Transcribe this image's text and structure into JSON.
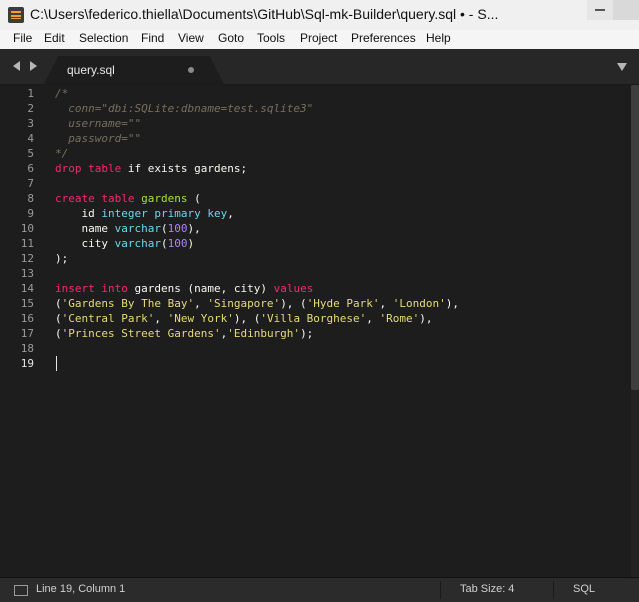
{
  "window": {
    "title": "C:\\Users\\federico.thiella\\Documents\\GitHub\\Sql-mk-Builder\\query.sql • - S..."
  },
  "menu": {
    "items": [
      "File",
      "Edit",
      "Selection",
      "Find",
      "View",
      "Goto",
      "Tools",
      "Project",
      "Preferences",
      "Help"
    ]
  },
  "tabs": [
    {
      "label": "query.sql",
      "dirty": true
    }
  ],
  "editor": {
    "current_line": 19,
    "line_numbers": [
      "1",
      "2",
      "3",
      "4",
      "5",
      "6",
      "7",
      "8",
      "9",
      "10",
      "11",
      "12",
      "13",
      "14",
      "15",
      "16",
      "17",
      "18",
      "19"
    ],
    "lines": [
      [
        {
          "t": "/*",
          "c": "c"
        }
      ],
      [
        {
          "t": "  conn=\"dbi:SQLite:dbname=test.sqlite3\"",
          "c": "c"
        }
      ],
      [
        {
          "t": "  username=\"\"",
          "c": "c"
        }
      ],
      [
        {
          "t": "  password=\"\"",
          "c": "c"
        }
      ],
      [
        {
          "t": "*/",
          "c": "c"
        }
      ],
      [
        {
          "t": "drop",
          "c": "k"
        },
        {
          "t": " "
        },
        {
          "t": "table",
          "c": "k"
        },
        {
          "t": " if exists gardens;"
        }
      ],
      [],
      [
        {
          "t": "create",
          "c": "k"
        },
        {
          "t": " "
        },
        {
          "t": "table",
          "c": "k"
        },
        {
          "t": " "
        },
        {
          "t": "gardens",
          "c": "d"
        },
        {
          "t": " ("
        }
      ],
      [
        {
          "t": "    id "
        },
        {
          "t": "integer primary key",
          "c": "f"
        },
        {
          "t": ","
        }
      ],
      [
        {
          "t": "    name "
        },
        {
          "t": "varchar",
          "c": "f"
        },
        {
          "t": "("
        },
        {
          "t": "100",
          "c": "n"
        },
        {
          "t": "),"
        }
      ],
      [
        {
          "t": "    city "
        },
        {
          "t": "varchar",
          "c": "f"
        },
        {
          "t": "("
        },
        {
          "t": "100",
          "c": "n"
        },
        {
          "t": ")"
        }
      ],
      [
        {
          "t": ");"
        }
      ],
      [],
      [
        {
          "t": "insert",
          "c": "k"
        },
        {
          "t": " "
        },
        {
          "t": "into",
          "c": "k"
        },
        {
          "t": " gardens (name, city) "
        },
        {
          "t": "values",
          "c": "k"
        }
      ],
      [
        {
          "t": "("
        },
        {
          "t": "'Gardens By The Bay'",
          "c": "s"
        },
        {
          "t": ", "
        },
        {
          "t": "'Singapore'",
          "c": "s"
        },
        {
          "t": "), ("
        },
        {
          "t": "'Hyde Park'",
          "c": "s"
        },
        {
          "t": ", "
        },
        {
          "t": "'London'",
          "c": "s"
        },
        {
          "t": "),"
        }
      ],
      [
        {
          "t": "("
        },
        {
          "t": "'Central Park'",
          "c": "s"
        },
        {
          "t": ", "
        },
        {
          "t": "'New York'",
          "c": "s"
        },
        {
          "t": "), ("
        },
        {
          "t": "'Villa Borghese'",
          "c": "s"
        },
        {
          "t": ", "
        },
        {
          "t": "'Rome'",
          "c": "s"
        },
        {
          "t": "),"
        }
      ],
      [
        {
          "t": "("
        },
        {
          "t": "'Princes Street Gardens'",
          "c": "s"
        },
        {
          "t": ","
        },
        {
          "t": "'Edinburgh'",
          "c": "s"
        },
        {
          "t": ");"
        }
      ],
      [],
      []
    ]
  },
  "status": {
    "position": "Line 19, Column 1",
    "tab_size": "Tab Size: 4",
    "syntax": "SQL"
  },
  "colors": {
    "editor_bg": "#1d1d1d",
    "comment": "#75715e",
    "keyword": "#f92672",
    "type": "#66d9ef",
    "string": "#e6db74",
    "number": "#ae81ff",
    "definition": "#a6e22e"
  }
}
